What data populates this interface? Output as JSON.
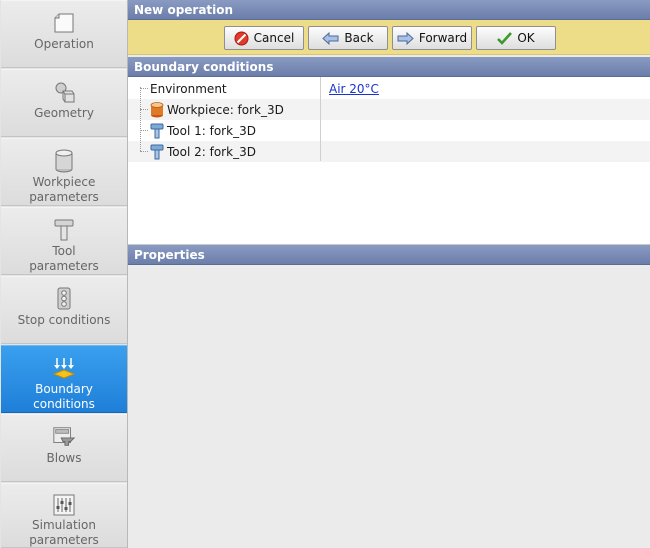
{
  "sidebar": {
    "items": [
      {
        "label": "Operation",
        "icon": "operation-icon"
      },
      {
        "label": "Geometry",
        "icon": "geometry-icon"
      },
      {
        "label": "Workpiece\nparameters",
        "icon": "workpiece-icon"
      },
      {
        "label": "Tool\nparameters",
        "icon": "tool-icon"
      },
      {
        "label": "Stop conditions",
        "icon": "traffic-light-icon"
      },
      {
        "label": "Boundary\nconditions",
        "icon": "boundary-icon",
        "active": true
      },
      {
        "label": "Blows",
        "icon": "blows-icon"
      },
      {
        "label": "Simulation\nparameters",
        "icon": "sliders-icon"
      }
    ]
  },
  "header": {
    "title": "New operation"
  },
  "toolbar": {
    "cancel": "Cancel",
    "back": "Back",
    "forward": "Forward",
    "ok": "OK"
  },
  "boundary": {
    "title": "Boundary conditions",
    "rows": [
      {
        "name": "Environment",
        "value": "Air 20°C",
        "icon": ""
      },
      {
        "name": "Workpiece: fork_3D",
        "value": "",
        "icon": "workpiece-icon"
      },
      {
        "name": "Tool 1: fork_3D",
        "value": "",
        "icon": "tool-icon"
      },
      {
        "name": "Tool 2: fork_3D",
        "value": "",
        "icon": "tool-icon"
      }
    ]
  },
  "properties": {
    "title": "Properties"
  },
  "colors": {
    "accent": "#1f7fd8",
    "header": "#6b7eaa",
    "toolbar": "#eedd88"
  }
}
